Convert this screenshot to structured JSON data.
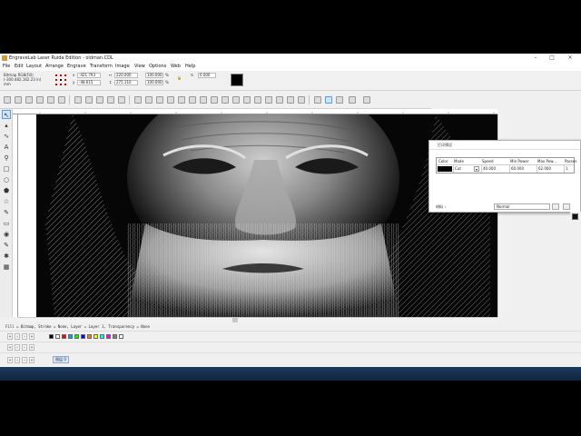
{
  "window": {
    "title": "EngraveLab Laser Ruida Edition - oldman.CDL"
  },
  "menu": {
    "items": [
      "File",
      "Edit",
      "Layout",
      "Arrange",
      "Engrave",
      "Transform",
      "Image",
      "View",
      "Options",
      "Web",
      "Help"
    ]
  },
  "properties": {
    "object_type": "Bitmap RGB(Fill)",
    "dimensions_line": "(-300.482,162.23 in)",
    "unit": "mm",
    "x_value": "-421.793",
    "y_value": "-48.615",
    "width_value": "220.000",
    "height_value": "275.110",
    "scale_x": "100.000",
    "scale_y": "100.000",
    "scale_unit": "%",
    "angle_value": "0.000"
  },
  "status": {
    "text": "Fill = Bitmap, Stroke = None, Layer = Layer 1, Transparency = None"
  },
  "layers": {
    "active_tab": "图层 0"
  },
  "laser_panel": {
    "title": "打印预设",
    "columns": [
      "Color",
      "Mode",
      "Speed",
      "Min Power",
      "Max Pow...",
      "Passes"
    ],
    "rows": [
      {
        "color": "#000000",
        "mode": "Cut",
        "speed": "40.000",
        "min_power": "60.000",
        "max_power": "62.000",
        "passes": "1"
      }
    ],
    "material_label": "材料",
    "material_value": "Normal"
  },
  "colors": {
    "accent": "#5b9bd5",
    "taskbar": "#1b3b5b"
  },
  "palette": [
    "#000000",
    "#ffffff",
    "#ff0000",
    "#00a0ff",
    "#00ff00",
    "#0000ff",
    "#ff8000",
    "#ffff00",
    "#00ffff",
    "#ff00ff",
    "#808080",
    "#ffffff"
  ]
}
